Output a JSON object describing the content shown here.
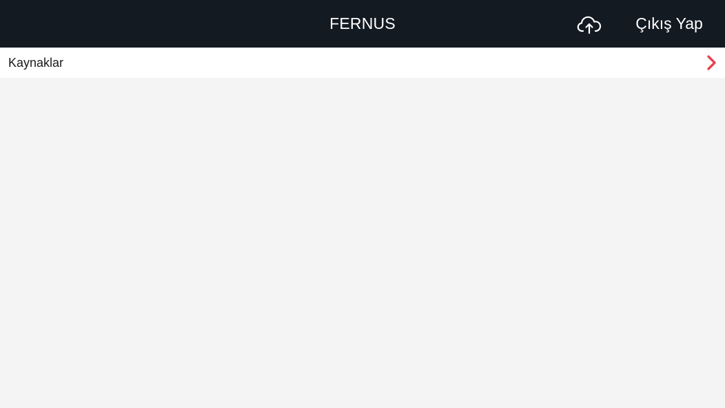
{
  "header": {
    "title": "FERNUS",
    "logout_label": "Çıkış Yap",
    "upload_icon": "cloud-upload-icon"
  },
  "list": {
    "items": [
      {
        "label": "Kaynaklar",
        "icon": "chevron-right-icon"
      }
    ]
  },
  "colors": {
    "header_bg": "#141a22",
    "header_text": "#ffffff",
    "content_bg": "#f4f4f4",
    "item_bg": "#ffffff",
    "chevron": "#e8414f"
  }
}
